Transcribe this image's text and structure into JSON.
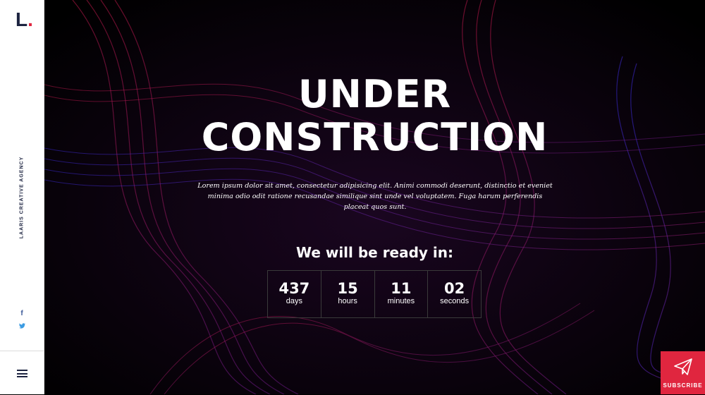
{
  "sidebar": {
    "logo_letter": "L",
    "logo_dot": ".",
    "agency_label": "Laaris Creative Agency",
    "social": {
      "facebook": "f",
      "twitter": "🐦"
    },
    "menu_icon": "hamburger-menu-icon"
  },
  "hero": {
    "title_line1": "UNDER",
    "title_line2": "CONSTRUCTION",
    "lead": "Lorem ipsum dolor sit amet, consectetur adipisicing elit. Animi commodi deserunt, distinctio et eveniet minima odio odit ratione recusandae similique sint unde vel voluptatem. Fuga harum perferendis placeat quos sunt.",
    "ready_heading": "We will be ready in:",
    "countdown": [
      {
        "value": "437",
        "unit": "days"
      },
      {
        "value": "15",
        "unit": "hours"
      },
      {
        "value": "11",
        "unit": "minutes"
      },
      {
        "value": "02",
        "unit": "seconds"
      }
    ]
  },
  "subscribe": {
    "label": "SUBSCRIBE",
    "icon": "paper-plane-icon"
  },
  "colors": {
    "accent": "#e0263f",
    "brand_dark": "#1c2340",
    "background": "#000000"
  }
}
